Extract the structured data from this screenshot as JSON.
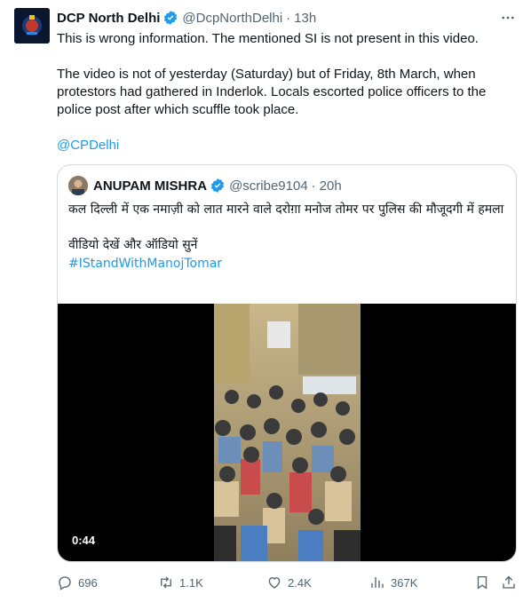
{
  "tweet": {
    "author_name": "DCP North Delhi",
    "handle": "@DcpNorthDelhi",
    "dot": "·",
    "time": "13h",
    "text_line1": "This is wrong information. The mentioned SI is not present in this video.",
    "text_line2": "The video is not of yesterday (Saturday) but of Friday, 8th March, when protestors had gathered in Inderlok. Locals  escorted police officers to the police post after which scuffle took place.",
    "mention": "@CPDelhi"
  },
  "quote": {
    "author_name": "ANUPAM MISHRA",
    "handle": "@scribe9104",
    "dot": "·",
    "time": "20h",
    "text_line1": "कल दिल्ली में एक नमाज़ी को लात मारने वाले दरोग़ा मनोज तोमर पर पुलिस की मौजूदगी में हमला",
    "text_line2": "वीडियो देखें और ऑडियो सुनें",
    "hashtag": "#IStandWithManojTomar",
    "video_duration": "0:44"
  },
  "actions": {
    "replies": "696",
    "retweets": "1.1K",
    "likes": "2.4K",
    "views": "367K"
  },
  "icons": {
    "verified": "verified-badge-icon",
    "more": "more-options-icon",
    "reply": "reply-icon",
    "retweet": "retweet-icon",
    "like": "heart-icon",
    "views": "views-chart-icon",
    "bookmark": "bookmark-icon",
    "share": "share-icon"
  },
  "colors": {
    "text": "#0f1419",
    "secondary": "#536471",
    "link": "#1d9bf0",
    "border": "#cfd9de"
  }
}
